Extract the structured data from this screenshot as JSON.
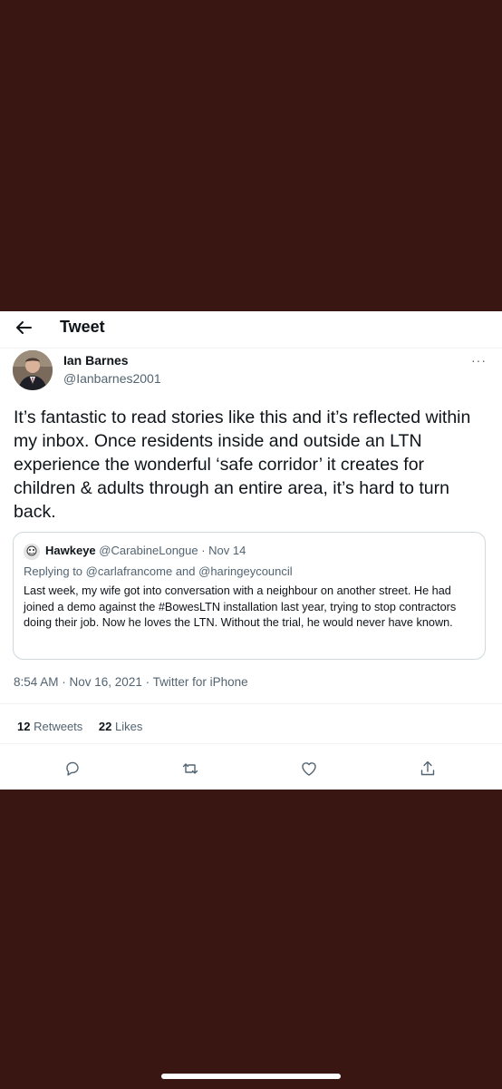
{
  "header": {
    "title": "Tweet",
    "back_icon": "arrow-left-icon"
  },
  "tweet": {
    "author_name": "Ian Barnes",
    "author_handle": "@Ianbarnes2001",
    "more_icon": "more-icon",
    "more_glyph": "···",
    "text": "It’s fantastic to read stories like this and it’s reflected within my inbox. Once residents inside and outside an LTN experience the wonderful ‘safe corridor’ it creates for children & adults through an entire area, it’s hard to turn back.",
    "timestamp": "8:54 AM · Nov 16, 2021 · Twitter for iPhone"
  },
  "quoted_tweet": {
    "author_name": "Hawkeye",
    "author_meta": "@CarabineLongue · Nov 14",
    "reply_line": "Replying to @carlafrancome and @haringeycouncil",
    "text": "Last week, my wife got into conversation with a neighbour on another street. He had joined a demo against the #BowesLTN installation last year, trying to stop contractors doing their job. Now he loves the LTN. Without the trial, he would never have known."
  },
  "stats": {
    "retweets_count": "12",
    "retweets_label": "Retweets",
    "likes_count": "22",
    "likes_label": "Likes"
  },
  "actions": [
    "reply-icon",
    "retweet-icon",
    "like-icon",
    "share-icon"
  ],
  "colors": {
    "background": "#3a1612",
    "card": "#ffffff",
    "secondary_text": "#536471",
    "divider": "#eff3f4"
  }
}
